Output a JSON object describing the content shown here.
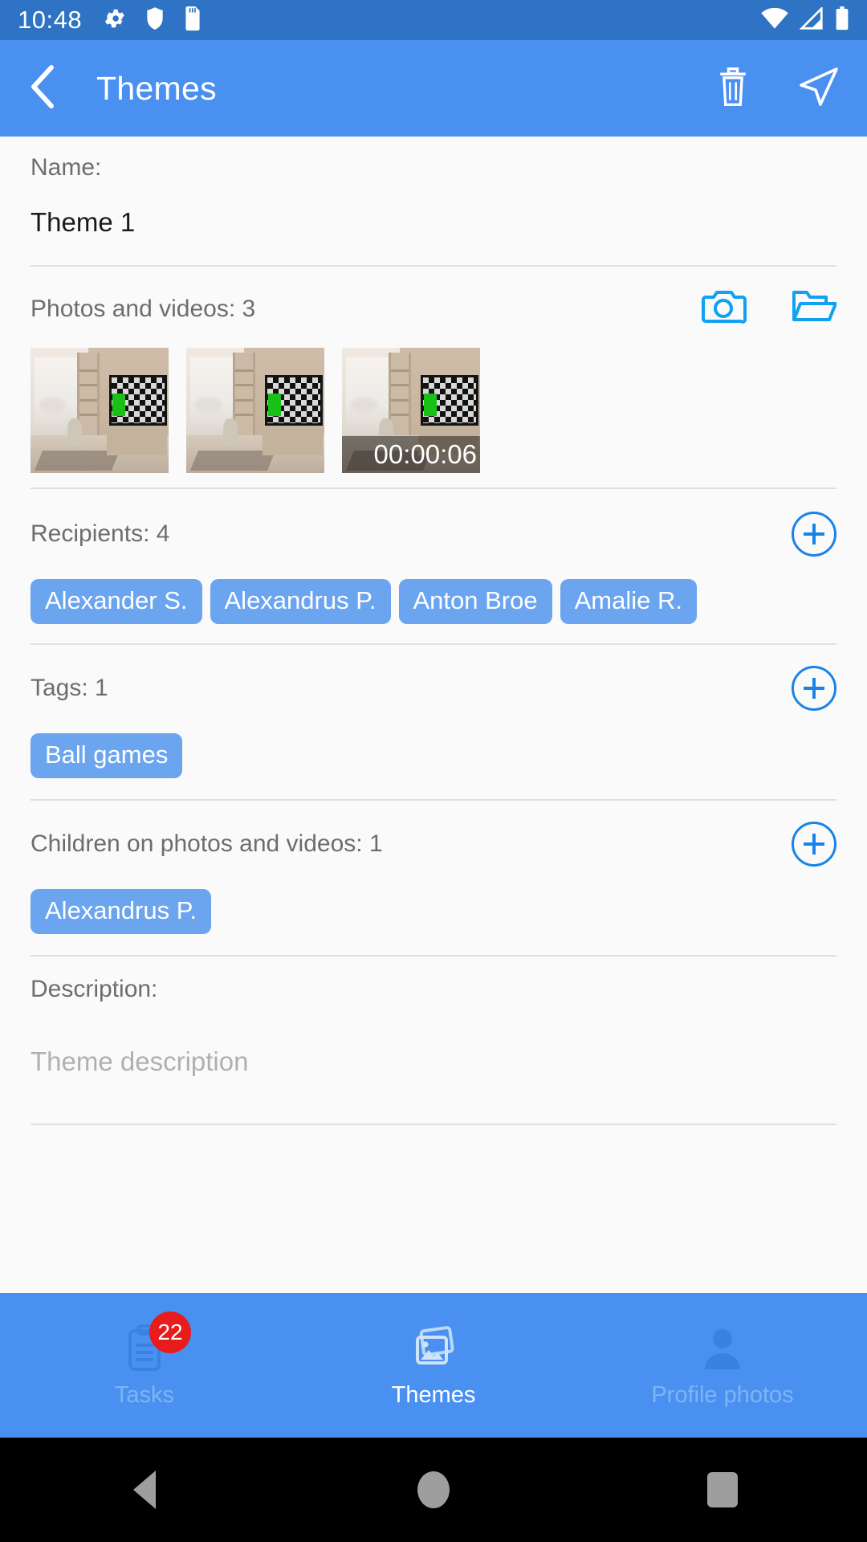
{
  "status_bar": {
    "time": "10:48",
    "left_icons": [
      "gear-icon",
      "shield-icon",
      "sd-card-icon"
    ],
    "right_icons": [
      "wifi-icon",
      "cellular-signal-icon",
      "battery-icon"
    ]
  },
  "app_bar": {
    "back_icon": "chevron-left-icon",
    "title": "Themes",
    "delete_icon": "trash-icon",
    "send_icon": "send-icon"
  },
  "form": {
    "name_label": "Name:",
    "name_value": "Theme 1",
    "media_label": "Photos and videos: 3",
    "camera_icon": "camera-icon",
    "folder_icon": "folder-open-icon",
    "thumbnails": [
      {
        "type": "photo",
        "duration": ""
      },
      {
        "type": "photo",
        "duration": ""
      },
      {
        "type": "video",
        "duration": "00:00:06"
      }
    ],
    "recipients_label": "Recipients: 4",
    "recipients": [
      "Alexander S.",
      "Alexandrus P.",
      "Anton Broe",
      "Amalie R."
    ],
    "tags_label": "Tags: 1",
    "tags": [
      "Ball games"
    ],
    "children_label": "Children on photos and videos: 1",
    "children": [
      "Alexandrus P."
    ],
    "description_label": "Description:",
    "description_placeholder": "Theme description",
    "add_icon": "plus-circle-icon"
  },
  "bottom_nav": {
    "items": [
      {
        "label": "Tasks",
        "icon": "clipboard-icon",
        "badge": "22",
        "active": false
      },
      {
        "label": "Themes",
        "icon": "photos-icon",
        "badge": "",
        "active": true
      },
      {
        "label": "Profile photos",
        "icon": "person-icon",
        "badge": "",
        "active": false
      }
    ]
  },
  "android_nav": {
    "back": "back-triangle-icon",
    "home": "home-circle-icon",
    "recents": "recents-square-icon"
  },
  "colors": {
    "status_bar": "#2f73c4",
    "app_bar": "#4a90f0",
    "accent": "#1a83e8",
    "chip": "#6ba4ef",
    "badge": "#e81c1c",
    "page_bg": "#fafafa"
  }
}
